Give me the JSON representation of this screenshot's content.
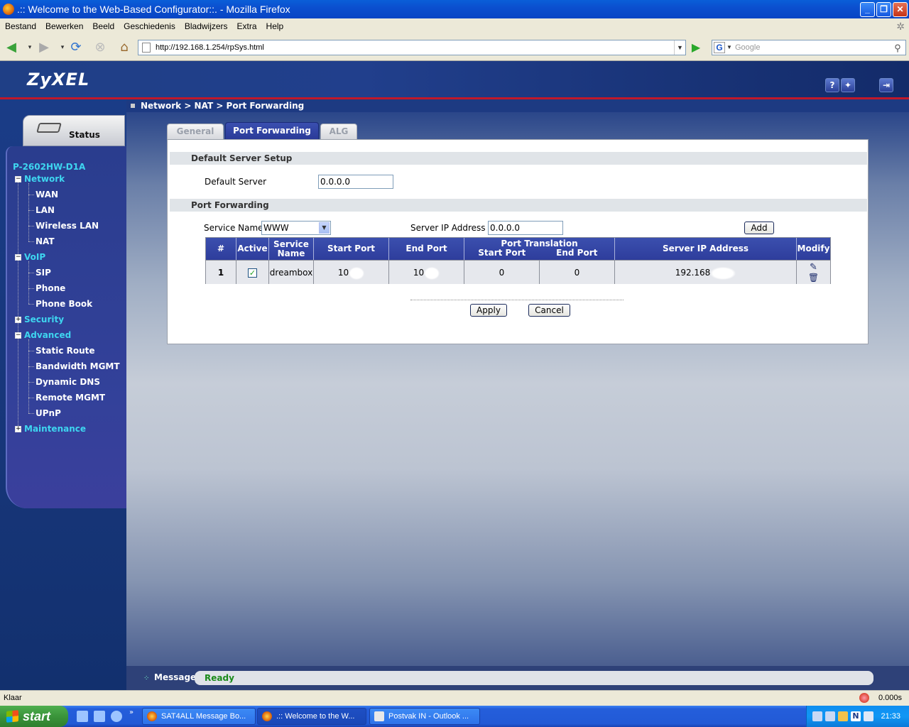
{
  "window": {
    "title": ".:: Welcome to the Web-Based Configurator::. - Mozilla Firefox"
  },
  "menu": [
    "Bestand",
    "Bewerken",
    "Beeld",
    "Geschiedenis",
    "Bladwijzers",
    "Extra",
    "Help"
  ],
  "address": {
    "url": "http://192.168.1.254/rpSys.html"
  },
  "search": {
    "placeholder": "Google"
  },
  "brand": {
    "logo": "ZyXEL"
  },
  "sidebar": {
    "status_label": "Status",
    "model": "P-2602HW-D1A",
    "groups": [
      {
        "label": "Network",
        "expanded": true,
        "items": [
          "WAN",
          "LAN",
          "Wireless LAN",
          "NAT"
        ]
      },
      {
        "label": "VoIP",
        "expanded": true,
        "items": [
          "SIP",
          "Phone",
          "Phone Book"
        ]
      },
      {
        "label": "Security",
        "expanded": false,
        "items": []
      },
      {
        "label": "Advanced",
        "expanded": true,
        "items": [
          "Static Route",
          "Bandwidth MGMT",
          "Dynamic DNS",
          "Remote MGMT",
          "UPnP"
        ]
      },
      {
        "label": "Maintenance",
        "expanded": false,
        "items": []
      }
    ]
  },
  "breadcrumb": "Network > NAT > Port Forwarding",
  "tabs": [
    {
      "label": "General",
      "active": false
    },
    {
      "label": "Port Forwarding",
      "active": true
    },
    {
      "label": "ALG",
      "active": false
    }
  ],
  "default_server_section": {
    "title": "Default Server Setup",
    "field_label": "Default Server",
    "field_value": "0.0.0.0"
  },
  "port_forwarding_section": {
    "title": "Port Forwarding",
    "service_name_label": "Service Name",
    "service_name_selected": "WWW",
    "server_ip_label": "Server IP Address",
    "server_ip_value": "0.0.0.0",
    "add_button": "Add"
  },
  "table": {
    "headers": {
      "index": "#",
      "active": "Active",
      "service_name_line1": "Service",
      "service_name_line2": "Name",
      "start_port": "Start Port",
      "end_port": "End Port",
      "port_translation": "Port Translation",
      "pt_start": "Start Port",
      "pt_end": "End Port",
      "server_ip": "Server IP Address",
      "modify": "Modify"
    },
    "rows": [
      {
        "index": "1",
        "active": true,
        "service_name": "dreambox",
        "start_port": "10",
        "end_port": "10",
        "pt_start": "0",
        "pt_end": "0",
        "server_ip": "192.168"
      }
    ]
  },
  "buttons": {
    "apply": "Apply",
    "cancel": "Cancel"
  },
  "message_bar": {
    "label": "Message",
    "status": "Ready"
  },
  "statusbar": {
    "left": "Klaar",
    "timer": "0.000s"
  },
  "taskbar": {
    "start": "start",
    "tasks": [
      "SAT4ALL Message Bo...",
      ".:: Welcome to the W...",
      "Postvak IN - Outlook ..."
    ],
    "clock": "21:33"
  },
  "colors": {
    "accent_tab": "#2e3d9c",
    "sidebar_group": "#3ed6f0",
    "header_red": "#c0182a",
    "ready_text": "#1a8a1a"
  }
}
